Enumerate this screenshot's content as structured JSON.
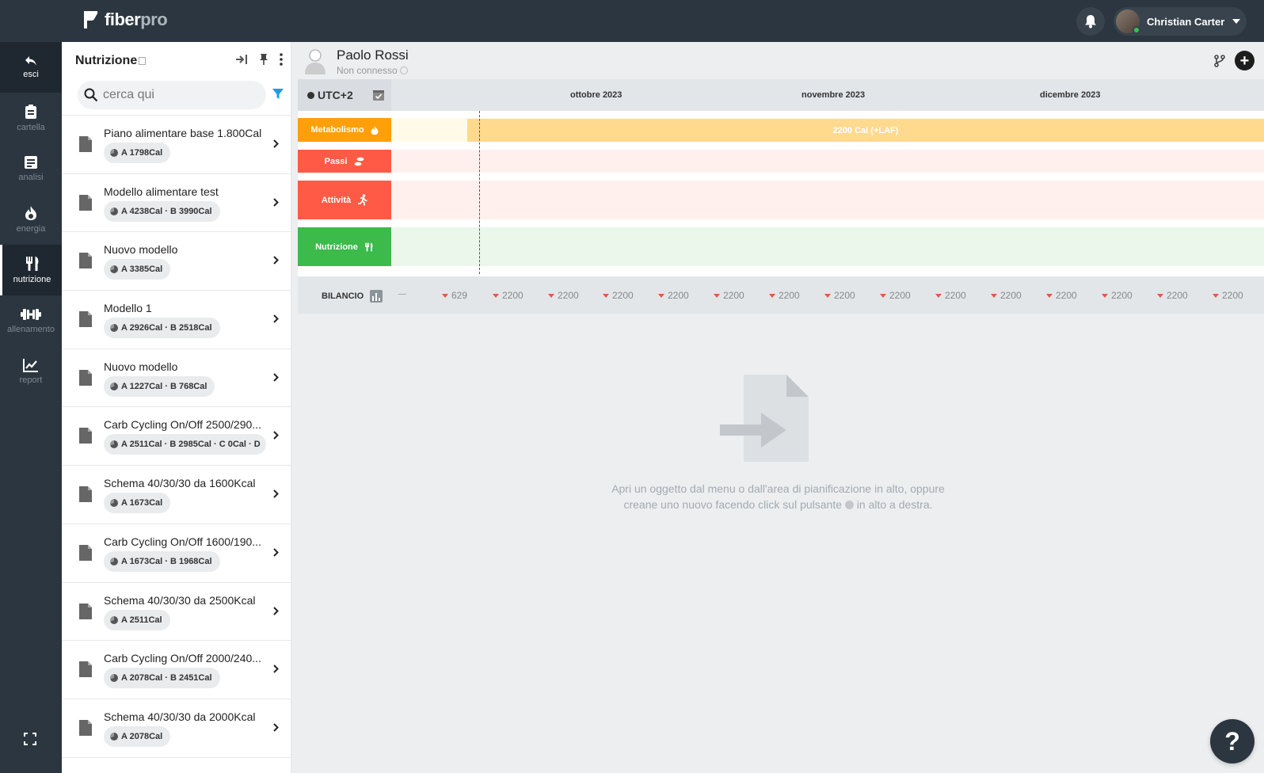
{
  "app": {
    "logo_main": "fiber",
    "logo_sub": "pro"
  },
  "user": {
    "name": "Christian Carter"
  },
  "rail": {
    "items": [
      {
        "label": "esci",
        "icon": "back-arrow-icon"
      },
      {
        "label": "cartella",
        "icon": "clipboard-icon"
      },
      {
        "label": "analisi",
        "icon": "document-icon"
      },
      {
        "label": "energia",
        "icon": "flame-icon"
      },
      {
        "label": "nutrizione",
        "icon": "fork-knife-icon"
      },
      {
        "label": "allenamento",
        "icon": "dumbbell-icon"
      },
      {
        "label": "report",
        "icon": "chart-icon"
      }
    ],
    "active": "nutrizione"
  },
  "panel": {
    "title": "Nutrizione",
    "search_placeholder": "cerca qui",
    "items": [
      {
        "title": "Piano alimentare base 1.800Cal",
        "badge": "A 1798Cal"
      },
      {
        "title": "Modello alimentare test",
        "badge": "A 4238Cal · B 3990Cal"
      },
      {
        "title": "Nuovo modello",
        "badge": "A 3385Cal"
      },
      {
        "title": "Modello 1",
        "badge": "A 2926Cal · B 2518Cal"
      },
      {
        "title": "Nuovo modello",
        "badge": "A 1227Cal · B 768Cal"
      },
      {
        "title": "Carb Cycling On/Off 2500/290...",
        "badge": "A 2511Cal · B 2985Cal · C 0Cal · D"
      },
      {
        "title": "Schema 40/30/30 da 1600Kcal",
        "badge": "A 1673Cal"
      },
      {
        "title": "Carb Cycling On/Off 1600/190...",
        "badge": "A 1673Cal · B 1968Cal"
      },
      {
        "title": "Schema 40/30/30 da 2500Kcal",
        "badge": "A 2511Cal"
      },
      {
        "title": "Carb Cycling On/Off 2000/240...",
        "badge": "A 2078Cal · B 2451Cal"
      },
      {
        "title": "Schema 40/30/30 da 2000Kcal",
        "badge": "A 2078Cal"
      }
    ]
  },
  "patient": {
    "name": "Paolo Rossi",
    "status": "Non connesso"
  },
  "timeline": {
    "timezone": "UTC+2",
    "months": [
      "ottobre 2023",
      "novembre 2023",
      "dicembre 2023"
    ],
    "rows": [
      {
        "label": "Metabolismo",
        "color": "#ff9f0a",
        "track": "#fffbe8"
      },
      {
        "label": "Passi",
        "color": "#ff5a45",
        "track": "#fff0ee"
      },
      {
        "label": "Attività",
        "color": "#ff5a45",
        "track": "#fff0ee"
      },
      {
        "label": "Nutrizione",
        "color": "#3cba4a",
        "track": "#eaf7ea"
      }
    ],
    "metab_bar_label": "2200 Cal (+LAF)"
  },
  "bilancio": {
    "label": "BILANCIO",
    "values": [
      "629",
      "2200",
      "2200",
      "2200",
      "2200",
      "2200",
      "2200",
      "2200",
      "2200",
      "2200",
      "2200",
      "2200",
      "2200",
      "2200",
      "2200"
    ]
  },
  "empty_state": {
    "line1": "Apri un oggetto dal menu o dall'area di pianificazione in alto, oppure",
    "line2_a": "creane uno nuovo facendo click sul pulsante",
    "line2_b": "in alto a destra."
  },
  "help": {
    "label": "?"
  }
}
